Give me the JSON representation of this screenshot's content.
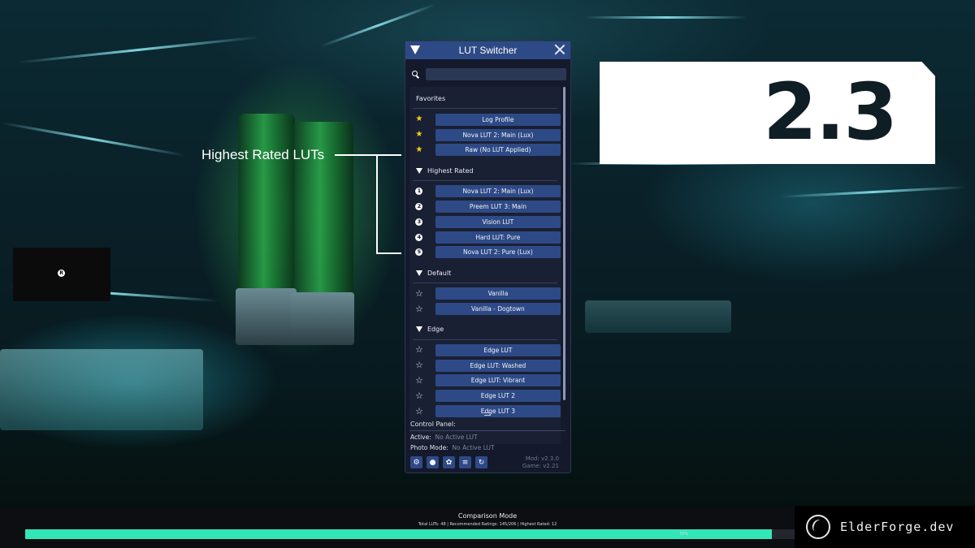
{
  "annotation": {
    "label": "Highest Rated LUTs"
  },
  "version_badge": "2.3",
  "video_overlay": {
    "badge": "R"
  },
  "panel": {
    "title": "LUT Switcher",
    "search": {
      "value": "",
      "placeholder": ""
    },
    "favorites": {
      "title": "Favorites",
      "items": [
        {
          "label": "Log Profile",
          "starred": true
        },
        {
          "label": "Nova LUT 2: Main (Lux)",
          "starred": true
        },
        {
          "label": "Raw (No LUT Applied)",
          "starred": true
        }
      ]
    },
    "highest_rated": {
      "title": "Highest Rated",
      "items": [
        {
          "rank": "1",
          "label": "Nova LUT 2: Main (Lux)"
        },
        {
          "rank": "2",
          "label": "Preem LUT 3: Main"
        },
        {
          "rank": "3",
          "label": "Vision LUT"
        },
        {
          "rank": "4",
          "label": "Hard LUT: Pure"
        },
        {
          "rank": "5",
          "label": "Nova LUT 2: Pure (Lux)"
        }
      ]
    },
    "default": {
      "title": "Default",
      "items": [
        {
          "label": "Vanilla"
        },
        {
          "label": "Vanilla - Dogtown"
        }
      ]
    },
    "edge": {
      "title": "Edge",
      "items": [
        {
          "label": "Edge LUT"
        },
        {
          "label": "Edge LUT: Washed"
        },
        {
          "label": "Edge LUT: Vibrant"
        },
        {
          "label": "Edge LUT 2"
        },
        {
          "label": "Edge LUT 3"
        }
      ]
    },
    "control_panel": {
      "label": "Control Panel:",
      "active_key": "Active:",
      "active_value": "No Active LUT",
      "photo_key": "Photo Mode:",
      "photo_value": "No Active LUT",
      "mod_version": "Mod: v2.3.0",
      "game_version": "Game: v2.21",
      "tools": [
        "gear-icon",
        "info-icon",
        "palette-icon",
        "list-icon",
        "refresh-icon"
      ]
    }
  },
  "comparison": {
    "title": "Comparison Mode",
    "stats": "Total LUTs: 48  |  Recommended Ratings: 145/206  |  Highest Rated: 12",
    "progress": 0.7,
    "progress_label": "70%"
  },
  "brand": {
    "text": "ElderForge.dev"
  },
  "colors": {
    "accent": "#2e4a86",
    "progress": "#33e6b8",
    "star": "#f2d21b"
  }
}
